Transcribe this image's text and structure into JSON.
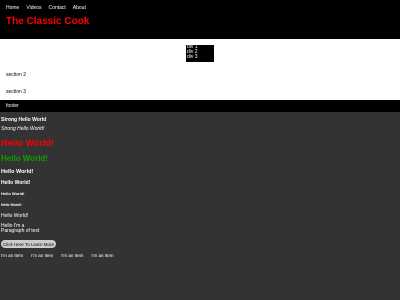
{
  "header": {
    "nav": [
      "Home",
      "Videos",
      "Contact",
      "About"
    ],
    "title": "The Classic Cook"
  },
  "main": {
    "div_block_lines": [
      "div 1",
      "div 2",
      "div 3"
    ],
    "section_2": "section 2",
    "section_3": "section 3"
  },
  "footer": {
    "text": "footer"
  },
  "demo": {
    "strong": "Strong Hello World",
    "strong_italic": "Strong Hello World!",
    "h1_red": "Hello World!",
    "h1_green": "Hello World!",
    "h3": "Hello World!",
    "h4": "Hello World!",
    "h5": "Hello World!",
    "h6": "Hello World!",
    "p": "Hello World!",
    "paragraph": "Hello I'm a Paragraph of text",
    "button_label": "Click Here To Learn More",
    "items": [
      "I'm an Item",
      "I'm an Item",
      "I'm an Item",
      "I'm an Item"
    ]
  },
  "colors": {
    "page_background": "#333333",
    "header_background": "#000000",
    "title_color": "#ff0000",
    "green_heading": "#0aa000",
    "button_background": "#cccccc"
  }
}
